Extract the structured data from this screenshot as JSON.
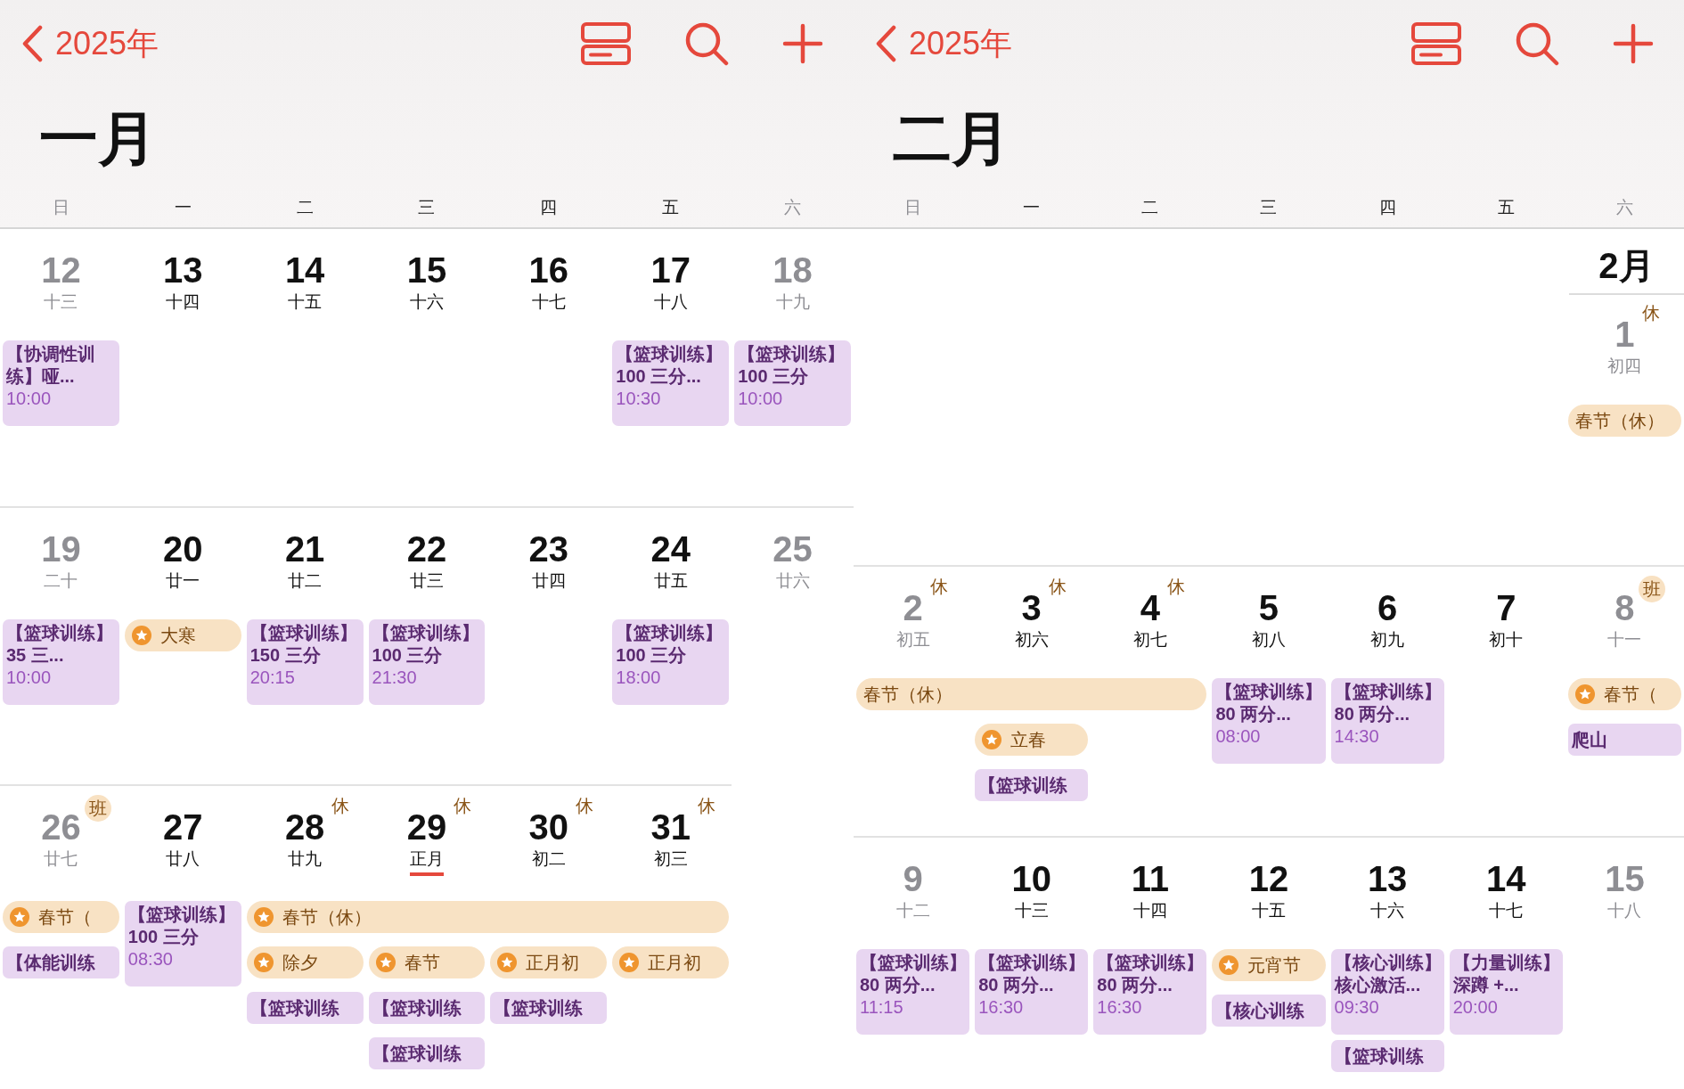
{
  "panels": [
    {
      "nav": {
        "back_label": "2025年"
      },
      "month": "一月",
      "weekdays": [
        {
          "label": "日",
          "weekend": true
        },
        {
          "label": "一",
          "weekend": false
        },
        {
          "label": "二",
          "weekend": false
        },
        {
          "label": "三",
          "weekend": false
        },
        {
          "label": "四",
          "weekend": false
        },
        {
          "label": "五",
          "weekend": false
        },
        {
          "label": "六",
          "weekend": true
        }
      ],
      "weeks": [
        {
          "days": [
            {
              "kind": "day",
              "number": "12",
              "lunar": "十三",
              "weekend": true,
              "underlined": false
            },
            {
              "kind": "day",
              "number": "13",
              "lunar": "十四",
              "weekend": false,
              "underlined": false
            },
            {
              "kind": "day",
              "number": "14",
              "lunar": "十五",
              "weekend": false,
              "underlined": false
            },
            {
              "kind": "day",
              "number": "15",
              "lunar": "十六",
              "weekend": false,
              "underlined": false
            },
            {
              "kind": "day",
              "number": "16",
              "lunar": "十七",
              "weekend": false,
              "underlined": false
            },
            {
              "kind": "day",
              "number": "17",
              "lunar": "十八",
              "weekend": false,
              "underlined": false
            },
            {
              "kind": "day",
              "number": "18",
              "lunar": "十九",
              "weekend": true,
              "underlined": false
            }
          ],
          "lanes": [
            [
              {
                "kind": "timed",
                "title": "【协调性训练】哑...",
                "time": "10:00"
              },
              {
                "kind": "none"
              },
              {
                "kind": "none"
              },
              {
                "kind": "none"
              },
              {
                "kind": "none"
              },
              {
                "kind": "timed",
                "title": "【篮球训练】",
                "detail": "100 三分...",
                "time": "10:30"
              },
              {
                "kind": "timed",
                "title": "【篮球训练】",
                "detail": "100 三分",
                "time": "10:00"
              }
            ]
          ]
        },
        {
          "days": [
            {
              "kind": "day",
              "number": "19",
              "lunar": "二十",
              "weekend": true,
              "underlined": false
            },
            {
              "kind": "day",
              "number": "20",
              "lunar": "廿一",
              "weekend": false,
              "underlined": false
            },
            {
              "kind": "day",
              "number": "21",
              "lunar": "廿二",
              "weekend": false,
              "underlined": false
            },
            {
              "kind": "day",
              "number": "22",
              "lunar": "廿三",
              "weekend": false,
              "underlined": false
            },
            {
              "kind": "day",
              "number": "23",
              "lunar": "廿四",
              "weekend": false,
              "underlined": false
            },
            {
              "kind": "day",
              "number": "24",
              "lunar": "廿五",
              "weekend": false,
              "underlined": false
            },
            {
              "kind": "day",
              "number": "25",
              "lunar": "廿六",
              "weekend": true,
              "underlined": false
            }
          ],
          "lanes": [
            [
              {
                "kind": "timed",
                "title": "【篮球训练】",
                "detail": "35 三...",
                "time": "10:00"
              },
              {
                "kind": "holiday",
                "title": "大寒",
                "star": true
              },
              {
                "kind": "timed",
                "title": "【篮球训练】",
                "detail": "150 三分",
                "time": "20:15"
              },
              {
                "kind": "timed",
                "title": "【篮球训练】",
                "detail": "100 三分",
                "time": "21:30"
              },
              {
                "kind": "none"
              },
              {
                "kind": "timed",
                "title": "【篮球训练】",
                "detail": "100 三分",
                "time": "18:00"
              },
              {
                "kind": "none"
              }
            ]
          ]
        },
        {
          "days": [
            {
              "kind": "day",
              "number": "26",
              "lunar": "廿七",
              "weekend": true,
              "underlined": false,
              "badge": {
                "text": "班",
                "kind": "work"
              }
            },
            {
              "kind": "day",
              "number": "27",
              "lunar": "廿八",
              "weekend": false,
              "underlined": false
            },
            {
              "kind": "day",
              "number": "28",
              "lunar": "廿九",
              "weekend": false,
              "underlined": false,
              "badge": {
                "text": "休",
                "kind": "rest"
              }
            },
            {
              "kind": "day",
              "number": "29",
              "lunar": "正月",
              "weekend": false,
              "underlined": true,
              "badge": {
                "text": "休",
                "kind": "rest"
              }
            },
            {
              "kind": "day",
              "number": "30",
              "lunar": "初二",
              "weekend": false,
              "underlined": false,
              "badge": {
                "text": "休",
                "kind": "rest"
              }
            },
            {
              "kind": "day",
              "number": "31",
              "lunar": "初三",
              "weekend": false,
              "underlined": false,
              "badge": {
                "text": "休",
                "kind": "rest"
              }
            },
            {
              "kind": "blank"
            }
          ],
          "lanes": [
            [
              {
                "kind": "holiday",
                "title": "春节（",
                "star": true
              },
              {
                "kind": "timed",
                "title": "【篮球训练】",
                "detail": "100 三分",
                "time": "08:30"
              },
              {
                "kind": "holiday",
                "title": "春节（休）",
                "star": true
              },
              {
                "kind": "continued"
              },
              {
                "kind": "continued"
              },
              {
                "kind": "continued"
              },
              {
                "kind": "none"
              }
            ],
            [
              {
                "kind": "allday",
                "title": "【体能训练"
              },
              {
                "kind": "none"
              },
              {
                "kind": "holiday",
                "title": "除夕",
                "star": true
              },
              {
                "kind": "holiday",
                "title": "春节",
                "star": true
              },
              {
                "kind": "holiday",
                "title": "正月初",
                "star": true
              },
              {
                "kind": "holiday",
                "title": "正月初",
                "star": true
              },
              {
                "kind": "none"
              }
            ],
            [
              {
                "kind": "none"
              },
              {
                "kind": "none"
              },
              {
                "kind": "allday",
                "title": "【篮球训练"
              },
              {
                "kind": "allday",
                "title": "【篮球训练"
              },
              {
                "kind": "allday",
                "title": "【篮球训练"
              },
              {
                "kind": "none"
              },
              {
                "kind": "none"
              }
            ],
            [
              {
                "kind": "none"
              },
              {
                "kind": "none"
              },
              {
                "kind": "none"
              },
              {
                "kind": "allday",
                "title": "【篮球训练"
              },
              {
                "kind": "none"
              },
              {
                "kind": "none"
              },
              {
                "kind": "none"
              }
            ]
          ]
        }
      ]
    },
    {
      "nav": {
        "back_label": "2025年"
      },
      "month": "二月",
      "weekdays": [
        {
          "label": "日",
          "weekend": true
        },
        {
          "label": "一",
          "weekend": false
        },
        {
          "label": "二",
          "weekend": false
        },
        {
          "label": "三",
          "weekend": false
        },
        {
          "label": "四",
          "weekend": false
        },
        {
          "label": "五",
          "weekend": false
        },
        {
          "label": "六",
          "weekend": true
        }
      ],
      "weeks": [
        {
          "days": [
            {
              "kind": "blank"
            },
            {
              "kind": "blank"
            },
            {
              "kind": "blank"
            },
            {
              "kind": "blank"
            },
            {
              "kind": "blank"
            },
            {
              "kind": "blank"
            },
            {
              "kind": "day",
              "month_label": "2月",
              "number": "1",
              "lunar": "初四",
              "weekend": true,
              "underlined": false,
              "badge": {
                "text": "休",
                "kind": "rest"
              }
            }
          ],
          "lanes": [
            [
              {
                "kind": "none"
              },
              {
                "kind": "none"
              },
              {
                "kind": "none"
              },
              {
                "kind": "none"
              },
              {
                "kind": "none"
              },
              {
                "kind": "none"
              },
              {
                "kind": "holiday",
                "title": "春节（休）",
                "star": false
              }
            ]
          ]
        },
        {
          "days": [
            {
              "kind": "day",
              "number": "2",
              "lunar": "初五",
              "weekend": true,
              "underlined": false,
              "badge": {
                "text": "休",
                "kind": "rest"
              }
            },
            {
              "kind": "day",
              "number": "3",
              "lunar": "初六",
              "weekend": false,
              "underlined": false,
              "badge": {
                "text": "休",
                "kind": "rest"
              }
            },
            {
              "kind": "day",
              "number": "4",
              "lunar": "初七",
              "weekend": false,
              "underlined": false,
              "badge": {
                "text": "休",
                "kind": "rest"
              }
            },
            {
              "kind": "day",
              "number": "5",
              "lunar": "初八",
              "weekend": false,
              "underlined": false
            },
            {
              "kind": "day",
              "number": "6",
              "lunar": "初九",
              "weekend": false,
              "underlined": false
            },
            {
              "kind": "day",
              "number": "7",
              "lunar": "初十",
              "weekend": false,
              "underlined": false
            },
            {
              "kind": "day",
              "number": "8",
              "lunar": "十一",
              "weekend": true,
              "underlined": false,
              "badge": {
                "text": "班",
                "kind": "work"
              }
            }
          ],
          "lanes": [
            [
              {
                "kind": "holiday",
                "title": "春节（休）",
                "star": false
              },
              {
                "kind": "continued"
              },
              {
                "kind": "continued"
              },
              {
                "kind": "timed",
                "title": "【篮球训练】",
                "detail": "80 两分...",
                "time": "08:00"
              },
              {
                "kind": "timed",
                "title": "【篮球训练】",
                "detail": "80 两分...",
                "time": "14:30"
              },
              {
                "kind": "none"
              },
              {
                "kind": "holiday",
                "title": "春节（",
                "star": true
              }
            ],
            [
              {
                "kind": "none"
              },
              {
                "kind": "holiday",
                "title": "立春",
                "star": true
              },
              {
                "kind": "none"
              },
              {
                "kind": "none"
              },
              {
                "kind": "none"
              },
              {
                "kind": "none"
              },
              {
                "kind": "allday",
                "title": "爬山"
              }
            ],
            [
              {
                "kind": "none"
              },
              {
                "kind": "allday",
                "title": "【篮球训练"
              },
              {
                "kind": "none"
              },
              {
                "kind": "none"
              },
              {
                "kind": "none"
              },
              {
                "kind": "none"
              },
              {
                "kind": "none"
              }
            ]
          ]
        },
        {
          "days": [
            {
              "kind": "day",
              "number": "9",
              "lunar": "十二",
              "weekend": true,
              "underlined": false
            },
            {
              "kind": "day",
              "number": "10",
              "lunar": "十三",
              "weekend": false,
              "underlined": false
            },
            {
              "kind": "day",
              "number": "11",
              "lunar": "十四",
              "weekend": false,
              "underlined": false
            },
            {
              "kind": "day",
              "number": "12",
              "lunar": "十五",
              "weekend": false,
              "underlined": false
            },
            {
              "kind": "day",
              "number": "13",
              "lunar": "十六",
              "weekend": false,
              "underlined": false
            },
            {
              "kind": "day",
              "number": "14",
              "lunar": "十七",
              "weekend": false,
              "underlined": false
            },
            {
              "kind": "day",
              "number": "15",
              "lunar": "十八",
              "weekend": true,
              "underlined": false
            }
          ],
          "lanes": [
            [
              {
                "kind": "timed",
                "title": "【篮球训练】",
                "detail": "80 两分...",
                "time": "11:15"
              },
              {
                "kind": "timed",
                "title": "【篮球训练】",
                "detail": "80 两分...",
                "time": "16:30"
              },
              {
                "kind": "timed",
                "title": "【篮球训练】",
                "detail": "80 两分...",
                "time": "16:30"
              },
              {
                "kind": "holiday",
                "title": "元宵节",
                "star": true
              },
              {
                "kind": "timed",
                "title": "【核心训练】",
                "detail": "核心激活...",
                "time": "09:30"
              },
              {
                "kind": "timed",
                "title": "【力量训练】",
                "detail": "深蹲 +...",
                "time": "20:00"
              },
              {
                "kind": "none"
              }
            ],
            [
              {
                "kind": "none"
              },
              {
                "kind": "none"
              },
              {
                "kind": "none"
              },
              {
                "kind": "allday",
                "title": "【核心训练"
              },
              {
                "kind": "none"
              },
              {
                "kind": "none"
              },
              {
                "kind": "none"
              }
            ],
            [
              {
                "kind": "none"
              },
              {
                "kind": "none"
              },
              {
                "kind": "none"
              },
              {
                "kind": "none"
              },
              {
                "kind": "allday",
                "title": "【篮球训练"
              },
              {
                "kind": "none"
              },
              {
                "kind": "none"
              }
            ]
          ]
        }
      ]
    }
  ]
}
